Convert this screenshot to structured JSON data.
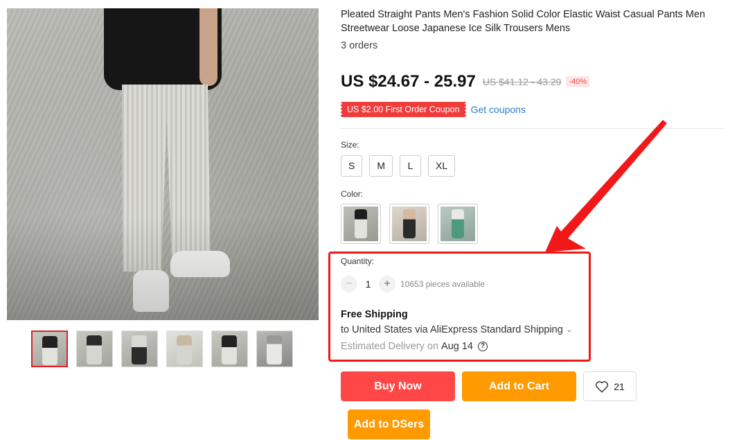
{
  "product": {
    "title": "Pleated Straight Pants Men's Fashion Solid Color Elastic Waist Casual Pants Men Streetwear Loose Japanese Ice Silk Trousers Mens",
    "orders": "3 orders",
    "price": "US $24.67 - 25.97",
    "original_price": "US $41.12 - 43.29",
    "discount": "-40%",
    "coupon": "US $2.00 First Order Coupon",
    "get_coupons": "Get coupons"
  },
  "size": {
    "label": "Size:",
    "options": [
      "S",
      "M",
      "L",
      "XL"
    ]
  },
  "color": {
    "label": "Color:",
    "options_count": 3
  },
  "quantity": {
    "label": "Quantity:",
    "minus": "−",
    "plus": "+",
    "value": "1",
    "available": "10653 pieces available"
  },
  "shipping": {
    "title": "Free Shipping",
    "method": "to United States via AliExpress Standard Shipping",
    "chevron": "⌄",
    "estimated_label": "Estimated Delivery on",
    "date": "Aug 14",
    "help": "?"
  },
  "actions": {
    "buy_now": "Buy Now",
    "add_to_cart": "Add to Cart",
    "wishlist_count": "21",
    "add_to_dsers": "Add to DSers"
  },
  "gallery": {
    "thumbnail_count": 6,
    "selected_index": 0
  },
  "colors": {
    "buy_now": "#ff4747",
    "add_to_cart": "#ff9a00",
    "coupon": "#f03b3b",
    "link": "#2e7cc6",
    "annotation": "#f01818"
  }
}
